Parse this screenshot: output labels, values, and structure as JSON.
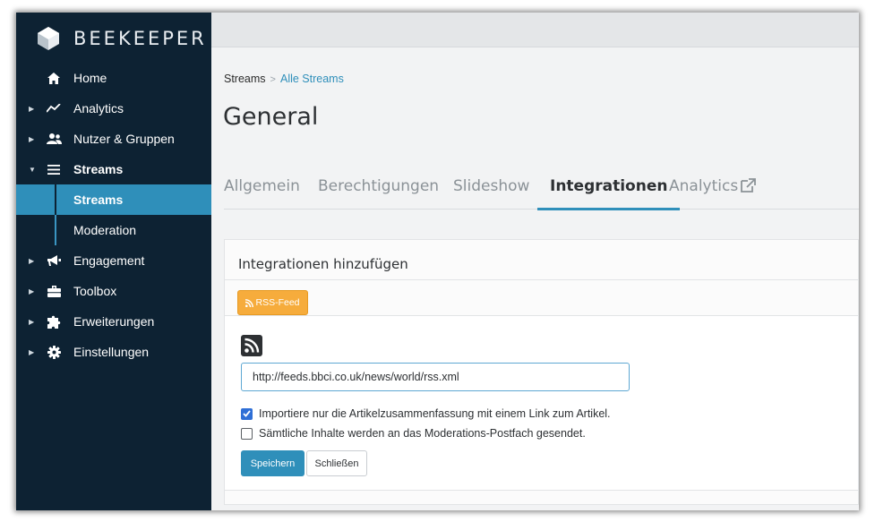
{
  "brand": {
    "name": "BEEKEEPER"
  },
  "sidebar": {
    "items": [
      {
        "label": "Home",
        "icon": "home-icon"
      },
      {
        "label": "Analytics",
        "icon": "analytics-icon"
      },
      {
        "label": "Nutzer & Gruppen",
        "icon": "users-icon"
      },
      {
        "label": "Streams",
        "icon": "menu-icon"
      },
      {
        "label": "Engagement",
        "icon": "megaphone-icon"
      },
      {
        "label": "Toolbox",
        "icon": "toolbox-icon"
      },
      {
        "label": "Erweiterungen",
        "icon": "puzzle-icon"
      },
      {
        "label": "Einstellungen",
        "icon": "gear-icon"
      }
    ],
    "streams_sub": [
      {
        "label": "Streams",
        "active": true
      },
      {
        "label": "Moderation",
        "active": false
      }
    ]
  },
  "breadcrumb": {
    "root": "Streams",
    "separator": ">",
    "current": "Alle Streams"
  },
  "page": {
    "title": "General"
  },
  "tabs": [
    {
      "label": "Allgemein"
    },
    {
      "label": "Berechtigungen"
    },
    {
      "label": "Slideshow"
    },
    {
      "label": "Integrationen",
      "active": true
    },
    {
      "label": "Analytics",
      "external": true
    }
  ],
  "integrations": {
    "title": "Integrationen hinzufügen",
    "rss_button": "RSS-Feed",
    "feed_url": "http://feeds.bbci.co.uk/news/world/rss.xml",
    "option_summary": {
      "label": "Importiere nur die Artikelzusammenfassung mit einem Link zum Artikel.",
      "checked": true
    },
    "option_moderation": {
      "label": "Sämtliche Inhalte werden an das Moderations-Postfach gesendet.",
      "checked": false
    },
    "save_label": "Speichern",
    "close_label": "Schließen"
  },
  "colors": {
    "sidebar_bg": "#0d2233",
    "accent": "#2f8fba",
    "rss_orange": "#f6ac3c"
  }
}
